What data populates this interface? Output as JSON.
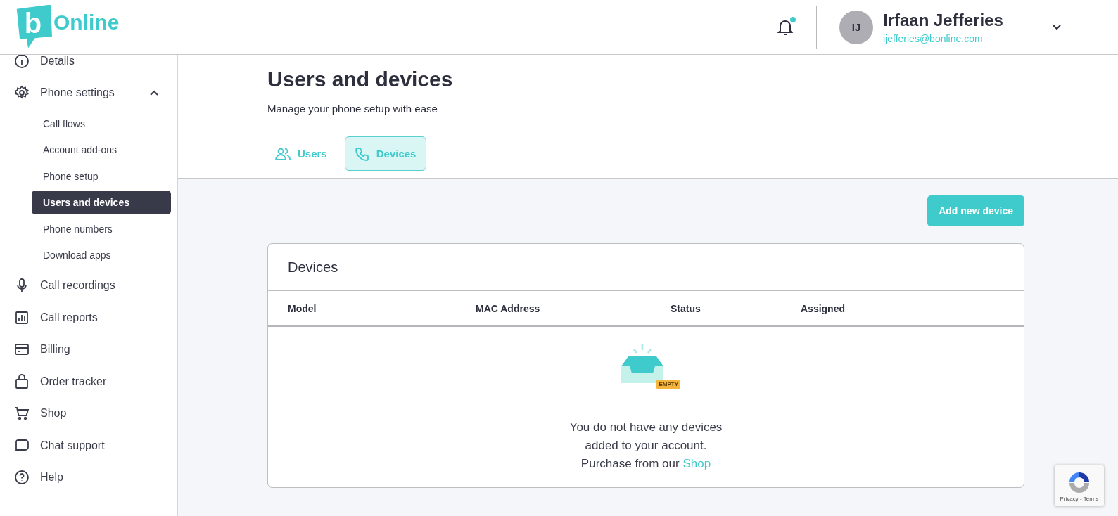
{
  "header": {
    "logo": {
      "mark": "b",
      "word": "Online"
    },
    "notifications": {
      "unread": true
    },
    "user": {
      "initials": "IJ",
      "name": "Irfaan Jefferies",
      "email": "ijefferies@bonline.com"
    }
  },
  "sidebar": {
    "items": [
      {
        "label": "Details",
        "selected": false
      },
      {
        "label": "Phone settings",
        "selected": false,
        "expanded": true,
        "children": [
          {
            "label": "Call flows",
            "selected": false
          },
          {
            "label": "Account add-ons",
            "selected": false
          },
          {
            "label": "Phone setup",
            "selected": false
          },
          {
            "label": "Users and devices",
            "selected": true
          },
          {
            "label": "Phone numbers",
            "selected": false
          },
          {
            "label": "Download apps",
            "selected": false
          }
        ]
      },
      {
        "label": "Call recordings",
        "selected": false
      },
      {
        "label": "Call reports",
        "selected": false
      },
      {
        "label": "Billing",
        "selected": false
      },
      {
        "label": "Order tracker",
        "selected": false
      },
      {
        "label": "Shop",
        "selected": false
      },
      {
        "label": "Chat support",
        "selected": false
      },
      {
        "label": "Help",
        "selected": false
      }
    ]
  },
  "page": {
    "title": "Users and devices",
    "subtitle": "Manage your phone setup with ease"
  },
  "tabs": [
    {
      "label": "Users",
      "selected": false
    },
    {
      "label": "Devices",
      "selected": true
    }
  ],
  "add_button": "Add new device",
  "devices_card": {
    "title": "Devices",
    "columns": [
      "Model",
      "MAC Address",
      "Status",
      "Assigned"
    ],
    "empty": {
      "tag": "EMPTY",
      "message": "You do not have any devices added to your account. Purchase from our",
      "link": "Shop"
    }
  },
  "recaptcha": {
    "links": "Privacy - Terms"
  }
}
